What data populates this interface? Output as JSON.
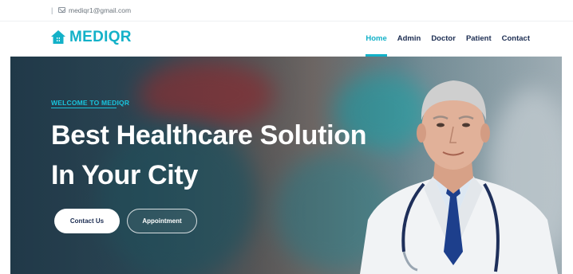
{
  "topbar": {
    "separator": "|",
    "email": "mediqr1@gmail.com",
    "email_icon": "envelope-icon"
  },
  "brand": {
    "name": "MEDIQR",
    "icon": "house-icon",
    "color": "#13b1c8"
  },
  "nav": {
    "items": [
      {
        "label": "Home",
        "active": true
      },
      {
        "label": "Admin",
        "active": false
      },
      {
        "label": "Doctor",
        "active": false
      },
      {
        "label": "Patient",
        "active": false
      },
      {
        "label": "Contact",
        "active": false
      }
    ]
  },
  "hero": {
    "welcome": "WELCOME TO MEDIQR",
    "title_line1": "Best Healthcare Solution",
    "title_line2": "In Your City",
    "primary_button": "Contact Us",
    "secondary_button": "Appointment",
    "accent": "#19c3dc"
  }
}
